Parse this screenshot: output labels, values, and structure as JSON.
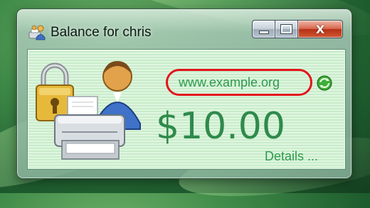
{
  "window": {
    "title": "Balance for chris",
    "caption_buttons": {
      "close": "X"
    }
  },
  "content": {
    "site_link": "www.example.org",
    "balance": "$10.00",
    "details_link": "Details ..."
  },
  "icons": {
    "app": "printer-users-icon",
    "illustration": "locked-printer-user-icon",
    "refresh": "green-refresh-icon"
  },
  "colors": {
    "link": "#2d9a4e",
    "balance": "#2f8a4c",
    "highlight_oval": "#e2141c"
  }
}
